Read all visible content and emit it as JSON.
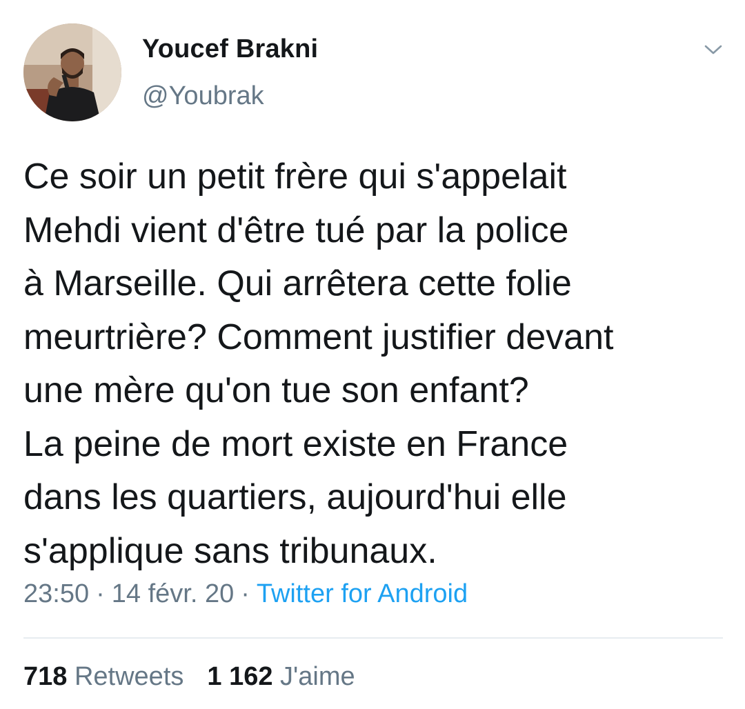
{
  "author": {
    "display_name": "Youcef Brakni",
    "handle": "@Youbrak",
    "avatar_icon": "profile-photo"
  },
  "menu": {
    "icon": "chevron-down-icon"
  },
  "tweet": {
    "lines": [
      "Ce soir un petit frère qui s'appelait",
      "Mehdi vient d'être tué par la police",
      "à Marseille. Qui arrêtera cette folie",
      "meurtrière? Comment justifier devant",
      "une mère qu'on tue son enfant?",
      "La peine de mort existe en France",
      "dans les quartiers, aujourd'hui elle",
      "s'applique sans tribunaux."
    ]
  },
  "meta": {
    "time": "23:50",
    "date": "14 févr. 20",
    "separator": "·",
    "source": "Twitter for Android"
  },
  "stats": {
    "retweets_count": "718",
    "retweets_label": "Retweets",
    "likes_count": "1 162",
    "likes_label": "J'aime"
  },
  "colors": {
    "text": "#14171a",
    "secondary": "#657786",
    "link": "#1da1f2",
    "divider": "#e6ecf0"
  }
}
